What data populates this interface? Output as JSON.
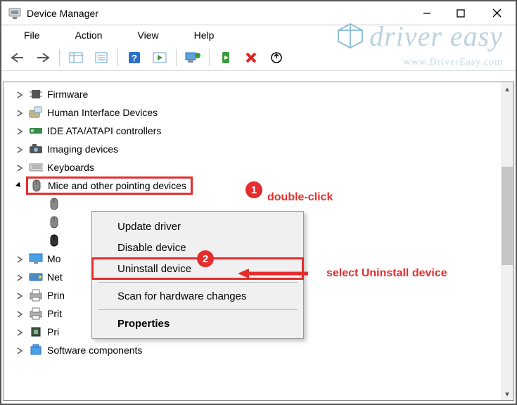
{
  "titlebar": {
    "title": "Device Manager"
  },
  "menubar": {
    "file": "File",
    "action": "Action",
    "view": "View",
    "help": "Help"
  },
  "tree": {
    "firmware": "Firmware",
    "hid": "Human Interface Devices",
    "ide": "IDE ATA/ATAPI controllers",
    "imaging": "Imaging devices",
    "keyboards": "Keyboards",
    "mice": "Mice and other pointing devices",
    "mo": "Mo",
    "ne": "Net",
    "pri": "Prin",
    "prit": "Prit",
    "proc": "Pri",
    "softcomp": "Software components"
  },
  "context_menu": {
    "update": "Update driver",
    "disable": "Disable device",
    "uninstall": "Uninstall device",
    "scan": "Scan for hardware changes",
    "properties": "Properties"
  },
  "annotations": {
    "step1": "1",
    "step1_text": "double-click",
    "step2": "2",
    "step2_text_prefix": "select ",
    "step2_text_bold": "Uninstall device"
  },
  "watermark": {
    "brand": "driver easy",
    "url": "www.DriverEasy.com"
  }
}
